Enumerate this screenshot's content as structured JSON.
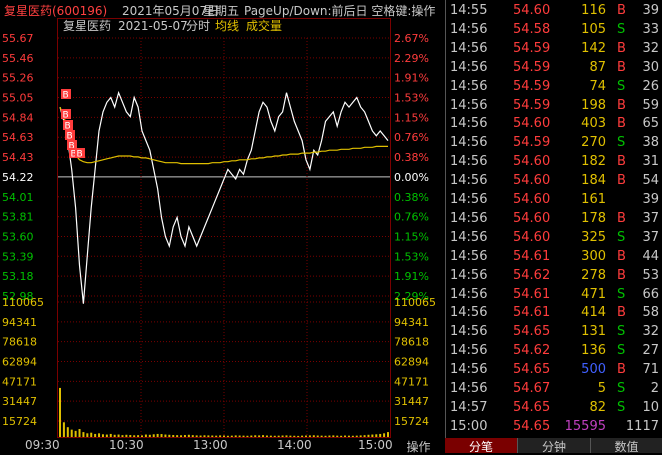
{
  "title": {
    "stock": "复星医药(600196)",
    "date": "2021年05月07日",
    "weekday": "星期五",
    "hint": "PageUp/Down:前后日 空格键:操作"
  },
  "legend": {
    "name": "复星医药",
    "date": "2021-05-07",
    "mode": "分时",
    "avg": "均线",
    "vol": "成交量"
  },
  "colors": {
    "up": "#ff3c3c",
    "down": "#00c000",
    "flat": "#ffffff",
    "price_line": "#ffffff",
    "avg_line": "#e0c000",
    "vol_bar": "#e0c000",
    "grid": "#7a0000",
    "buy_marker": "#ff3c3c",
    "big_vol": "#c040c0",
    "blue_vol": "#4060ff"
  },
  "price_axis": {
    "left": [
      "55.67",
      "55.46",
      "55.26",
      "55.05",
      "54.84",
      "54.63",
      "54.43",
      "54.22",
      "54.01",
      "53.81",
      "53.60",
      "53.39",
      "53.18",
      "52.98"
    ],
    "right": [
      "2.67%",
      "2.29%",
      "1.91%",
      "1.53%",
      "1.15%",
      "0.76%",
      "0.38%",
      "0.00%",
      "0.38%",
      "0.76%",
      "1.15%",
      "1.53%",
      "1.91%",
      "2.29%"
    ]
  },
  "volume_axis": [
    "110065",
    "94341",
    "78618",
    "62894",
    "47171",
    "31447",
    "15724"
  ],
  "time_axis": [
    "09:30",
    "10:30",
    "13:00",
    "14:00",
    "15:00"
  ],
  "operate_label": "操作",
  "chart_data": {
    "type": "line",
    "prev_close": 54.22,
    "ylim": [
      52.98,
      55.67
    ],
    "price_series": [
      54.95,
      54.8,
      54.6,
      54.3,
      53.9,
      53.3,
      52.9,
      53.4,
      53.9,
      54.3,
      54.7,
      54.9,
      55.0,
      55.05,
      54.95,
      55.1,
      55.0,
      54.9,
      54.85,
      55.05,
      54.95,
      54.7,
      54.6,
      54.5,
      54.3,
      54.1,
      53.8,
      53.6,
      53.5,
      53.7,
      53.8,
      53.6,
      53.5,
      53.7,
      53.6,
      53.5,
      53.6,
      53.7,
      53.8,
      53.9,
      54.0,
      54.1,
      54.2,
      54.3,
      54.25,
      54.2,
      54.3,
      54.25,
      54.4,
      54.5,
      54.7,
      54.9,
      55.0,
      54.95,
      54.8,
      54.7,
      54.85,
      54.9,
      55.1,
      54.95,
      54.8,
      54.7,
      54.6,
      54.4,
      54.3,
      54.5,
      54.45,
      54.6,
      54.8,
      54.85,
      54.9,
      54.75,
      54.9,
      55.0,
      54.95,
      55.0,
      55.05,
      54.95,
      54.9,
      54.8,
      54.7,
      54.65,
      54.7,
      54.65,
      54.6
    ],
    "avg_series": [
      54.95,
      54.85,
      54.7,
      54.55,
      54.45,
      54.4,
      54.38,
      54.37,
      54.37,
      54.38,
      54.39,
      54.4,
      54.41,
      54.42,
      54.43,
      54.44,
      54.44,
      54.44,
      54.44,
      54.43,
      54.43,
      54.42,
      54.42,
      54.41,
      54.4,
      54.39,
      54.38,
      54.37,
      54.37,
      54.37,
      54.37,
      54.36,
      54.36,
      54.36,
      54.36,
      54.36,
      54.36,
      54.36,
      54.36,
      54.37,
      54.37,
      54.37,
      54.38,
      54.38,
      54.39,
      54.39,
      54.4,
      54.4,
      54.4,
      54.41,
      54.41,
      54.42,
      54.42,
      54.43,
      54.43,
      54.44,
      54.44,
      54.45,
      54.45,
      54.46,
      54.46,
      54.46,
      54.47,
      54.47,
      54.47,
      54.48,
      54.48,
      54.49,
      54.49,
      54.5,
      54.5,
      54.5,
      54.51,
      54.51,
      54.51,
      54.52,
      54.52,
      54.52,
      54.53,
      54.53,
      54.53,
      54.54,
      54.54,
      54.54,
      54.54
    ],
    "volume_max": 110065,
    "volume_series": [
      40000,
      12000,
      8000,
      6000,
      5000,
      6500,
      4000,
      3000,
      3500,
      2500,
      3000,
      2200,
      2000,
      2500,
      1800,
      2000,
      1500,
      1800,
      1600,
      1400,
      1500,
      1300,
      2000,
      1800,
      2200,
      2500,
      2400,
      2000,
      1800,
      1600,
      1500,
      1400,
      1600,
      1800,
      1500,
      1300,
      1200,
      1400,
      1300,
      1200,
      1100,
      1300,
      1200,
      1000,
      1100,
      1300,
      1200,
      1100,
      1000,
      1200,
      1400,
      1300,
      1500,
      1200,
      1100,
      1000,
      1100,
      1200,
      1300,
      1100,
      1000,
      900,
      1100,
      1200,
      1300,
      1400,
      1200,
      1100,
      1000,
      1200,
      1300,
      1100,
      1000,
      1200,
      1100,
      1000,
      1100,
      1300,
      1500,
      1800,
      2000,
      2200,
      2500,
      3000,
      4000
    ],
    "markers": [
      "B",
      "B",
      "B",
      "B",
      "B",
      "B",
      "B"
    ]
  },
  "trades": [
    {
      "time": "14:55",
      "price": "54.60",
      "vol": "116",
      "side": "B",
      "count": "39"
    },
    {
      "time": "14:56",
      "price": "54.58",
      "vol": "105",
      "side": "S",
      "count": "33"
    },
    {
      "time": "14:56",
      "price": "54.59",
      "vol": "142",
      "side": "B",
      "count": "32"
    },
    {
      "time": "14:56",
      "price": "54.59",
      "vol": "87",
      "side": "B",
      "count": "30"
    },
    {
      "time": "14:56",
      "price": "54.59",
      "vol": "74",
      "side": "S",
      "count": "26"
    },
    {
      "time": "14:56",
      "price": "54.59",
      "vol": "198",
      "side": "B",
      "count": "59"
    },
    {
      "time": "14:56",
      "price": "54.60",
      "vol": "403",
      "side": "B",
      "count": "65"
    },
    {
      "time": "14:56",
      "price": "54.59",
      "vol": "270",
      "side": "S",
      "count": "38"
    },
    {
      "time": "14:56",
      "price": "54.60",
      "vol": "182",
      "side": "B",
      "count": "31"
    },
    {
      "time": "14:56",
      "price": "54.60",
      "vol": "184",
      "side": "B",
      "count": "54"
    },
    {
      "time": "14:56",
      "price": "54.60",
      "vol": "161",
      "side": "",
      "count": "39"
    },
    {
      "time": "14:56",
      "price": "54.60",
      "vol": "178",
      "side": "B",
      "count": "37"
    },
    {
      "time": "14:56",
      "price": "54.60",
      "vol": "325",
      "side": "S",
      "count": "37"
    },
    {
      "time": "14:56",
      "price": "54.61",
      "vol": "300",
      "side": "B",
      "count": "44"
    },
    {
      "time": "14:56",
      "price": "54.62",
      "vol": "278",
      "side": "B",
      "count": "53"
    },
    {
      "time": "14:56",
      "price": "54.61",
      "vol": "471",
      "side": "S",
      "count": "66"
    },
    {
      "time": "14:56",
      "price": "54.61",
      "vol": "414",
      "side": "B",
      "count": "58"
    },
    {
      "time": "14:56",
      "price": "54.65",
      "vol": "131",
      "side": "S",
      "count": "32"
    },
    {
      "time": "14:56",
      "price": "54.62",
      "vol": "136",
      "side": "S",
      "count": "27"
    },
    {
      "time": "14:56",
      "price": "54.65",
      "vol": "500",
      "side": "B",
      "count": "71"
    },
    {
      "time": "14:56",
      "price": "54.67",
      "vol": "5",
      "side": "S",
      "count": "2"
    },
    {
      "time": "14:57",
      "price": "54.65",
      "vol": "82",
      "side": "S",
      "count": "10"
    },
    {
      "time": "15:00",
      "price": "54.65",
      "vol": "15595",
      "side": "",
      "count": "1117"
    }
  ],
  "tabs": [
    "分笔",
    "分钟",
    "数值"
  ]
}
